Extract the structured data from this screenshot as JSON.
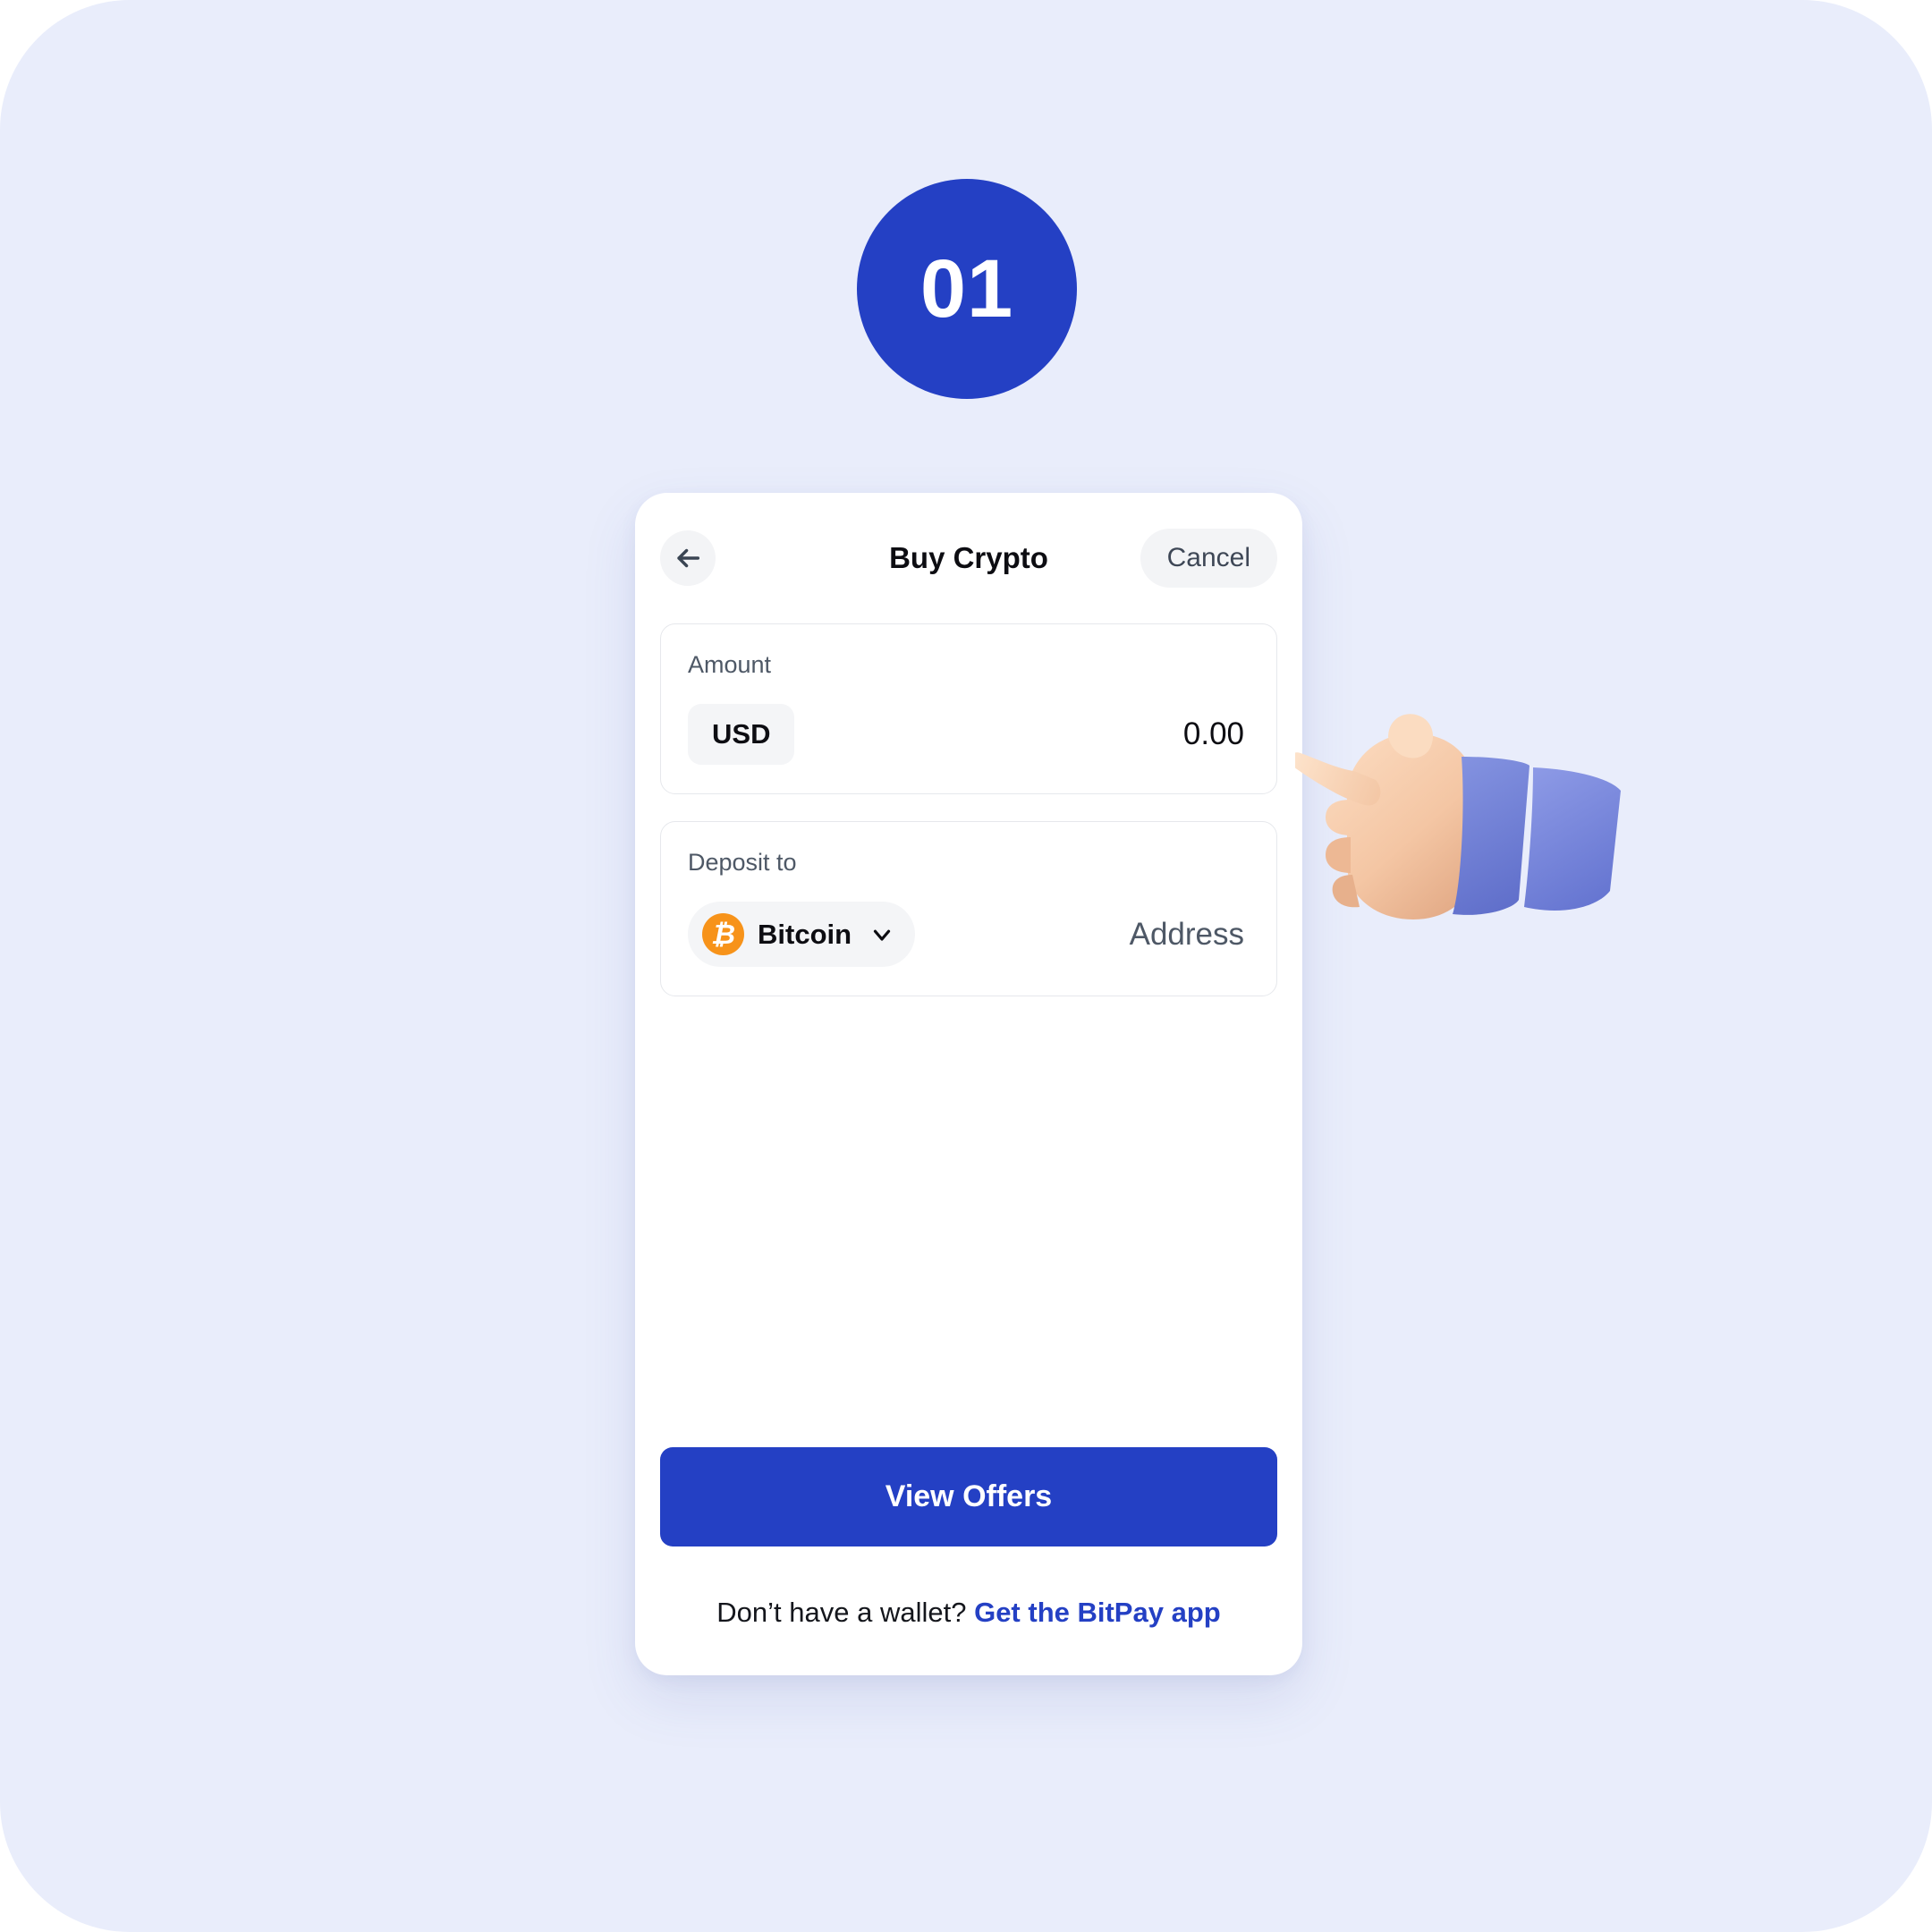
{
  "theme": {
    "canvas_background": "#e9edfb",
    "brand_blue": "#2440c4",
    "chip_gray": "#f4f5f7",
    "border_gray": "#e6e8ec",
    "bitcoin_orange": "#f7931a",
    "text_dark": "#0d0d12",
    "text_muted": "#4e5866"
  },
  "step_badge": {
    "number": "01"
  },
  "header": {
    "back_icon": "arrow-left-icon",
    "title": "Buy Crypto",
    "cancel_label": "Cancel"
  },
  "amount_field": {
    "label": "Amount",
    "currency": "USD",
    "value": "0.00"
  },
  "deposit_field": {
    "label": "Deposit to",
    "asset_symbol": "₿",
    "asset_name": "Bitcoin",
    "chevron_icon": "chevron-down-icon",
    "address_placeholder": "Address"
  },
  "actions": {
    "primary_label": "View Offers"
  },
  "footer": {
    "prompt": "Don’t have a wallet? ",
    "link_label": "Get the BitPay app"
  },
  "pointer": {
    "icon": "pointing-hand-cursor"
  }
}
